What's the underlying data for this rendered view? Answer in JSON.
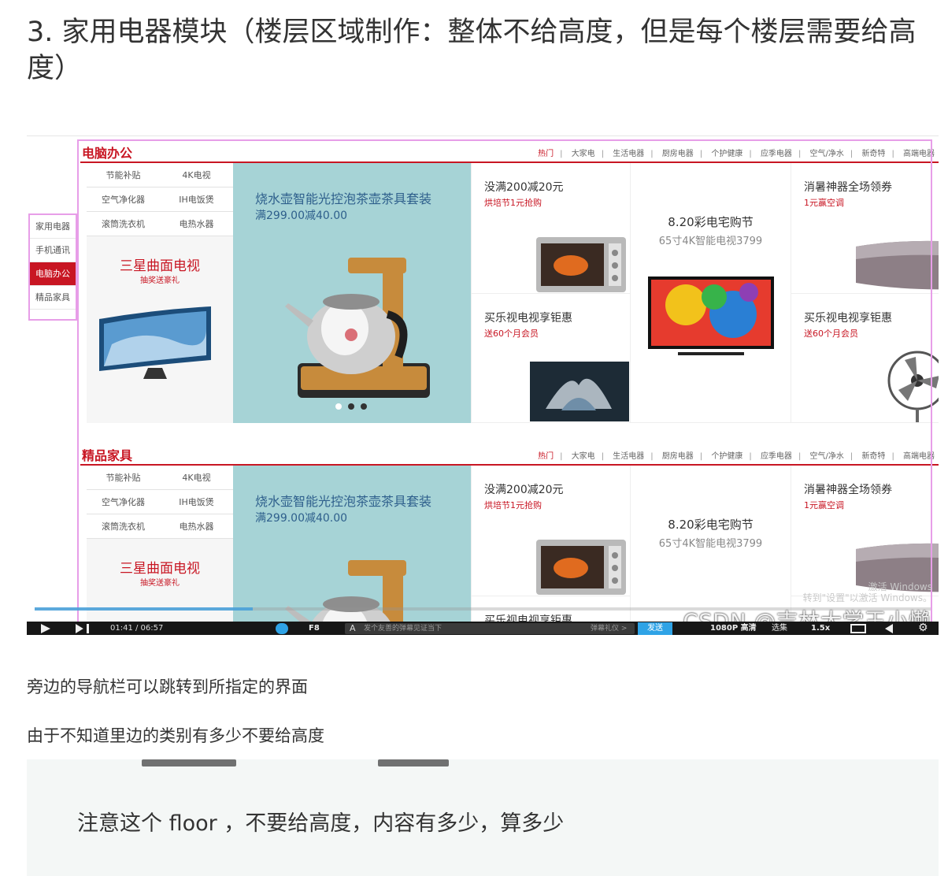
{
  "heading": "3. 家用电器模块（楼层区域制作：整体不给高度，但是每个楼层需要给高度）",
  "video": {
    "sidenav": [
      {
        "label": "家用电器",
        "active": false
      },
      {
        "label": "手机通讯",
        "active": false
      },
      {
        "label": "电脑办公",
        "active": true
      },
      {
        "label": "精品家具",
        "active": false
      }
    ],
    "tabs": [
      "热门",
      "大家电",
      "生活电器",
      "厨房电器",
      "个护健康",
      "应季电器",
      "空气/净水",
      "新奇特",
      "高端电器"
    ],
    "floors": [
      {
        "title": "电脑办公",
        "categories": [
          "节能补贴",
          "4K电视",
          "空气净化器",
          "IH电饭煲",
          "滚筒洗衣机",
          "电热水器"
        ],
        "promo": {
          "title": "三星曲面电视",
          "sub": "抽奖送豪礼"
        },
        "banner": {
          "title": "烧水壶智能光控泡茶壶茶具套装",
          "sub": "满299.00减40.00"
        },
        "cells": {
          "a": {
            "title": "没满200减20元",
            "sub": "烘培节1元抢购"
          },
          "b": {
            "title": "买乐视电视享钜惠",
            "sub": "送60个月会员"
          },
          "c": {
            "title": "8.20彩电宅购节",
            "sub": "65寸4K智能电视3799"
          },
          "d": {
            "title": "消暑神器全场领券",
            "sub": "1元赢空调"
          },
          "e": {
            "title": "买乐视电视享钜惠",
            "sub": "送60个月会员"
          }
        }
      },
      {
        "title": "精品家具",
        "categories": [
          "节能补贴",
          "4K电视",
          "空气净化器",
          "IH电饭煲",
          "滚筒洗衣机",
          "电热水器"
        ],
        "promo": {
          "title": "三星曲面电视",
          "sub": "抽奖送豪礼"
        },
        "banner": {
          "title": "烧水壶智能光控泡茶壶茶具套装",
          "sub": "满299.00减40.00"
        },
        "cells": {
          "a": {
            "title": "没满200减20元",
            "sub": "烘培节1元抢购"
          },
          "b": {
            "title": "买乐视电视享钜惠",
            "sub": ""
          },
          "c": {
            "title": "8.20彩电宅购节",
            "sub": "65寸4K智能电视3799"
          },
          "d": {
            "title": "消暑神器全场领券",
            "sub": "1元赢空调"
          },
          "e": {
            "title": "",
            "sub": ""
          }
        }
      }
    ],
    "watermark": "激活 Windows\n转到\"设置\"以激活 Windows。",
    "csdn_watermark": "CSDN @吉林大学王小懒",
    "player": {
      "time": "01:41 / 06:57",
      "danmaku_setting": "F8",
      "danmaku_placeholder": "发个友善的弹幕见证当下",
      "danmaku_etiquette": "弹幕礼仪 >",
      "send": "发送",
      "quality": "1080P 高清",
      "episodes": "选集",
      "speed": "1.5x",
      "settings_icon": "⚙",
      "progress": 0.243
    }
  },
  "paragraphs": [
    "旁边的导航栏可以跳转到所指定的界面",
    "由于不知道里边的类别有多少不要给高度"
  ],
  "note": "注意这个 floor ，不要给高度，内容有多少，算多少",
  "colors": {
    "accent": "#c81623",
    "frame": "#e79ee8",
    "banner": "#a6d3d6",
    "player": "#171717",
    "send": "#2fa3e6"
  }
}
